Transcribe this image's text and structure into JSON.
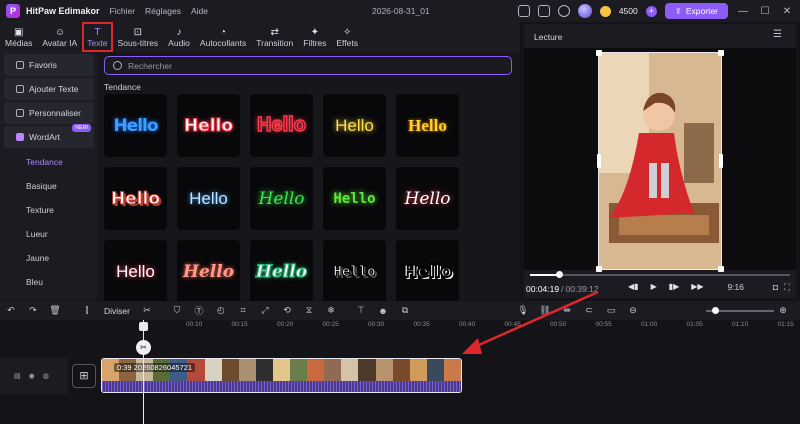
{
  "titlebar": {
    "app_name": "HitPaw Edimakor",
    "menu": [
      "Fichier",
      "Réglages",
      "Aide"
    ],
    "doc_title": "2026-08-31_01",
    "credits": "4500",
    "export_label": "Exporter"
  },
  "tabs": [
    {
      "label": "Médias",
      "icon": "media-icon"
    },
    {
      "label": "Avatar IA",
      "icon": "avatar-icon"
    },
    {
      "label": "Texte",
      "icon": "text-icon",
      "active": true
    },
    {
      "label": "Sous-titres",
      "icon": "subtitles-icon"
    },
    {
      "label": "Audio",
      "icon": "music-note-icon"
    },
    {
      "label": "Autocollants",
      "icon": "sticker-icon"
    },
    {
      "label": "Transition",
      "icon": "transition-icon"
    },
    {
      "label": "Filtres",
      "icon": "filter-icon"
    },
    {
      "label": "Effets",
      "icon": "effects-icon"
    }
  ],
  "sidebar": {
    "groups": [
      "Favoris",
      "Ajouter Texte",
      "Personnaliser",
      "WordArt"
    ],
    "new_badge": "NEW",
    "subitems": [
      "Tendance",
      "Basique",
      "Texture",
      "Lueur",
      "Jaune",
      "Bleu"
    ],
    "active_subitem": "Tendance"
  },
  "content": {
    "search_placeholder": "Rechercher",
    "section_label": "Tendance",
    "tiles_text": "Hello",
    "tile_colors": [
      "#3aa0ff",
      "#ff3b4e",
      "#ff3b4e",
      "#ffe14a",
      "#ffcf2a",
      "#ffffff",
      "#bfe3ff",
      "#37e84a",
      "#5ee63a",
      "#ff4b5c",
      "#ff3b4e",
      "#ff9a8a",
      "#3fe0a0",
      "#ffffff",
      "#ffffff"
    ]
  },
  "preview": {
    "title": "Lecture",
    "current_time": "00:04:19",
    "total_time": "00:39:12",
    "progress": 0.11,
    "ratio": "9:16"
  },
  "timeline": {
    "split_label": "Diviser",
    "ticks": [
      "00:10",
      "00:15",
      "00:20",
      "00:25",
      "00:30",
      "00:35",
      "00:40",
      "00:45",
      "00:50",
      "00:55",
      "01:00",
      "01:05",
      "01:10",
      "01:15"
    ],
    "clip_label": "0:39 20260826045721"
  },
  "colors": {
    "accent": "#8b5cf6",
    "highlight": "#e0262d"
  }
}
